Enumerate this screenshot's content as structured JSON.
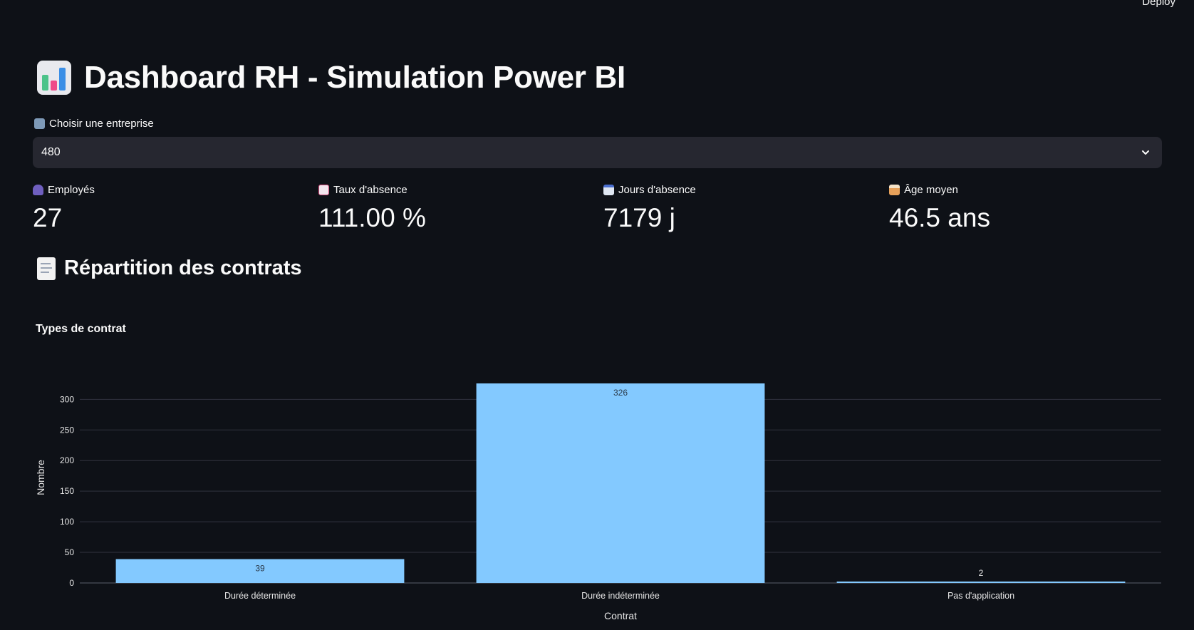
{
  "header": {
    "deploy_label": "Deploy",
    "title": "Dashboard RH - Simulation Power BI",
    "title_icon": "bar-chart-icon"
  },
  "company_select": {
    "label": "Choisir une entreprise",
    "label_icon": "office-building-icon",
    "value": "480"
  },
  "metrics": [
    {
      "icon": "people-icon",
      "label": "Employés",
      "value": "27"
    },
    {
      "icon": "chart-decreasing-icon",
      "label": "Taux d'absence",
      "value": "111.00 %"
    },
    {
      "icon": "calendar-icon",
      "label": "Jours d'absence",
      "value": "7179 j"
    },
    {
      "icon": "birthday-cake-icon",
      "label": "Âge moyen",
      "value": "46.5 ans"
    }
  ],
  "section": {
    "title": "Répartition des contrats",
    "icon": "document-icon"
  },
  "chart_data": {
    "type": "bar",
    "title": "Types de contrat",
    "xlabel": "Contrat",
    "ylabel": "Nombre",
    "categories": [
      "Durée déterminée",
      "Durée indéterminée",
      "Pas d'application"
    ],
    "values": [
      39,
      326,
      2
    ],
    "ylim": [
      0,
      326
    ],
    "yticks": [
      0,
      50,
      100,
      150,
      200,
      250,
      300
    ],
    "bar_color": "#83c9ff",
    "grid": true,
    "legend": "none"
  }
}
